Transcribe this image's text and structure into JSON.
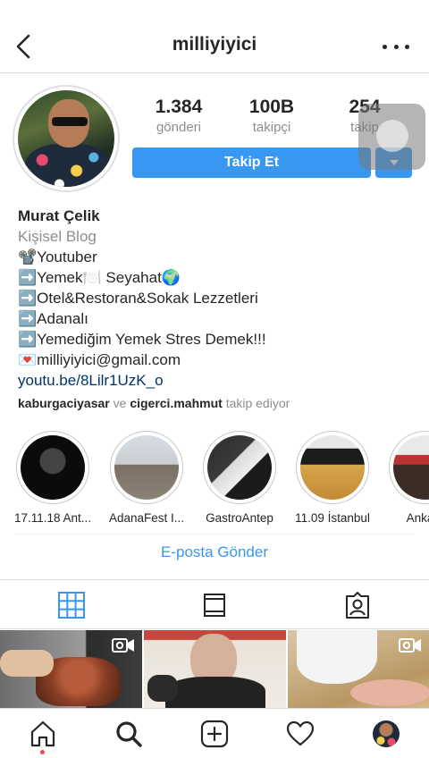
{
  "header": {
    "username": "milliyiyici",
    "back_icon": "chevron-left-icon",
    "more_icon": "more-horizontal-icon"
  },
  "profile": {
    "stats": [
      {
        "value": "1.384",
        "label": "gönderi"
      },
      {
        "value": "100B",
        "label": "takipçi"
      },
      {
        "value": "254",
        "label": "takip"
      }
    ],
    "follow_label": "Takip Et",
    "dropdown_icon": "caret-down-icon"
  },
  "bio": {
    "name": "Murat Çelik",
    "category": "Kişisel Blog",
    "lines": [
      "📽️Youtuber",
      "➡️Yemek🍽️ Seyahat🌍",
      "➡️Otel&Restoran&Sokak Lezzetleri",
      "➡️Adanalı",
      "➡️Yemediğim Yemek Stres Demek!!!",
      "💌milliyiyici@gmail.com"
    ],
    "link": "youtu.be/8Lilr1UzK_o",
    "followed_by_1": "kaburgaciyasar",
    "followed_by_and": "ve",
    "followed_by_2": "cigerci.mahmut",
    "followed_by_suffix": "takip ediyor"
  },
  "highlights": [
    {
      "label": "17.11.18 Ant..."
    },
    {
      "label": "AdanaFest I..."
    },
    {
      "label": "GastroAntep"
    },
    {
      "label": "11.09 İstanbul"
    },
    {
      "label": "Ankara"
    }
  ],
  "email_button": "E-posta Gönder",
  "tabs": [
    "grid-icon",
    "feed-icon",
    "tagged-icon"
  ],
  "bottom_nav": [
    "home-icon",
    "search-icon",
    "add-post-icon",
    "heart-icon",
    "profile-avatar"
  ],
  "colors": {
    "accent": "#3897f0",
    "text": "#262626",
    "muted": "#8e8e8e",
    "link": "#003569",
    "notification": "#ed4956"
  }
}
